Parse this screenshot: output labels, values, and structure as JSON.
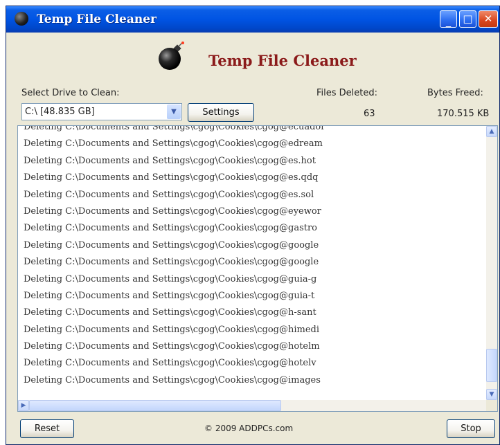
{
  "window": {
    "title": "Temp File Cleaner"
  },
  "header": {
    "title": "Temp File Cleaner",
    "logo_icon": "bomb-icon"
  },
  "drive": {
    "label": "Select Drive to Clean:",
    "selected": "C:\\ [48.835 GB]"
  },
  "settings_button": "Settings",
  "stats": {
    "files_deleted_label": "Files Deleted:",
    "files_deleted_value": "63",
    "bytes_freed_label": "Bytes Freed:",
    "bytes_freed_value": "170.515 KB"
  },
  "log": {
    "lines": [
      "Deleting C:\\Documents and Settings\\cgog\\Cookies\\cgog@ecuador",
      "Deleting C:\\Documents and Settings\\cgog\\Cookies\\cgog@edream",
      "Deleting C:\\Documents and Settings\\cgog\\Cookies\\cgog@es.hot",
      "Deleting C:\\Documents and Settings\\cgog\\Cookies\\cgog@es.qdq",
      "Deleting C:\\Documents and Settings\\cgog\\Cookies\\cgog@es.sol",
      "Deleting C:\\Documents and Settings\\cgog\\Cookies\\cgog@eyewor",
      "Deleting C:\\Documents and Settings\\cgog\\Cookies\\cgog@gastro",
      "Deleting C:\\Documents and Settings\\cgog\\Cookies\\cgog@google",
      "Deleting C:\\Documents and Settings\\cgog\\Cookies\\cgog@google",
      "Deleting C:\\Documents and Settings\\cgog\\Cookies\\cgog@guia-g",
      "Deleting C:\\Documents and Settings\\cgog\\Cookies\\cgog@guia-t",
      "Deleting C:\\Documents and Settings\\cgog\\Cookies\\cgog@h-sant",
      "Deleting C:\\Documents and Settings\\cgog\\Cookies\\cgog@himedi",
      "Deleting C:\\Documents and Settings\\cgog\\Cookies\\cgog@hotelm",
      "Deleting C:\\Documents and Settings\\cgog\\Cookies\\cgog@hotelv",
      "Deleting C:\\Documents and Settings\\cgog\\Cookies\\cgog@images"
    ]
  },
  "footer": {
    "reset_label": "Reset",
    "copyright": "© 2009 ADDPCs.com",
    "stop_label": "Stop"
  },
  "icons": {
    "app": "bomb-icon",
    "minimize": "minimize-icon",
    "maximize": "maximize-icon",
    "close": "close-icon",
    "dropdown": "chevron-down-icon"
  },
  "colors": {
    "title_bar": "#0054e3",
    "header_title": "#8b1a1a",
    "window_bg": "#ece9d8",
    "close_button": "#d8461e"
  }
}
